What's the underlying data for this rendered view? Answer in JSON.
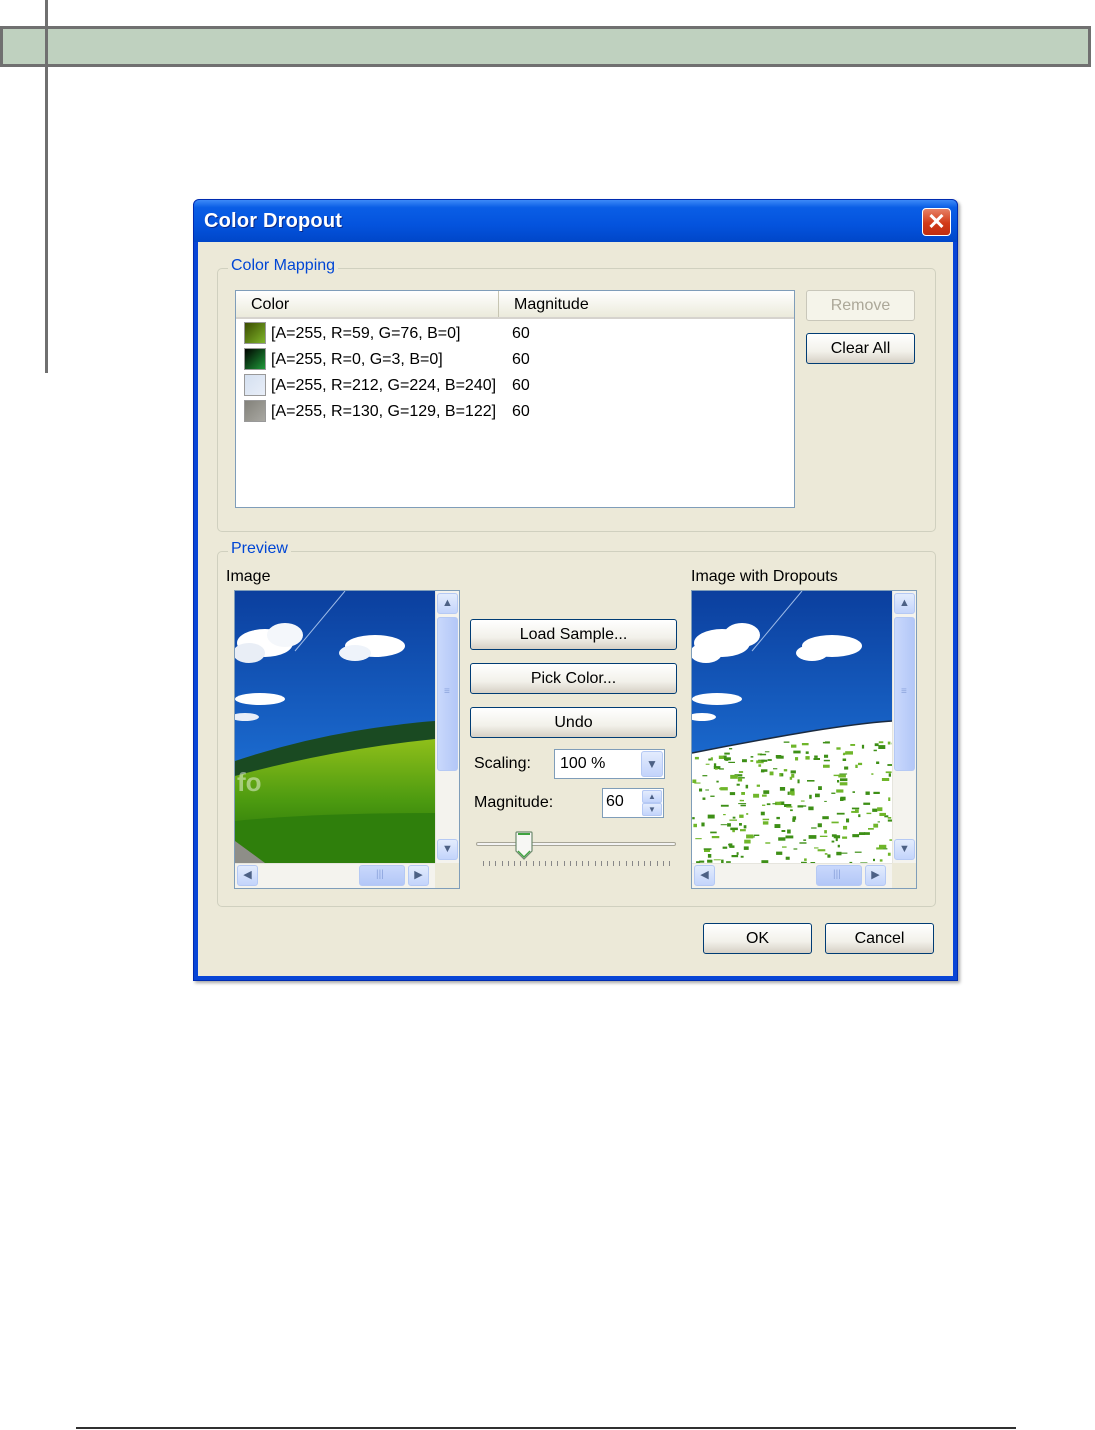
{
  "dialog": {
    "title": "Color Dropout",
    "close_glyph": "✕"
  },
  "color_mapping": {
    "group_label": "Color Mapping",
    "columns": {
      "color": "Color",
      "magnitude": "Magnitude"
    },
    "rows": [
      {
        "swatch": "#3b4c00",
        "swatch_light": "#7fb52a",
        "text": "[A=255, R=59, G=76, B=0]",
        "magnitude": "60"
      },
      {
        "swatch": "#000300",
        "swatch_light": "#1f9a3a",
        "text": "[A=255, R=0, G=3, B=0]",
        "magnitude": "60"
      },
      {
        "swatch": "#d4e0f0",
        "swatch_light": "#e8eef8",
        "text": "[A=255, R=212, G=224, B=240]",
        "magnitude": "60"
      },
      {
        "swatch": "#82817a",
        "swatch_light": "#a9a8a2",
        "text": "[A=255, R=130, G=129, B=122]",
        "magnitude": "60"
      }
    ],
    "remove_label": "Remove",
    "clear_all_label": "Clear All"
  },
  "preview": {
    "group_label": "Preview",
    "image_label": "Image",
    "dropouts_label": "Image with Dropouts",
    "load_sample_label": "Load Sample...",
    "pick_color_label": "Pick Color...",
    "undo_label": "Undo",
    "scaling_label": "Scaling:",
    "scaling_value": "100 %",
    "magnitude_label": "Magnitude:",
    "magnitude_value": "60",
    "magnitude_slider_fraction": 0.24,
    "watermark": "fo"
  },
  "footer": {
    "ok_label": "OK",
    "cancel_label": "Cancel"
  },
  "colors": {
    "titlebar": "#0453dd",
    "group_label": "#0046d5",
    "dialog_face": "#ece9d8",
    "page_header": "#bfd1bf"
  }
}
